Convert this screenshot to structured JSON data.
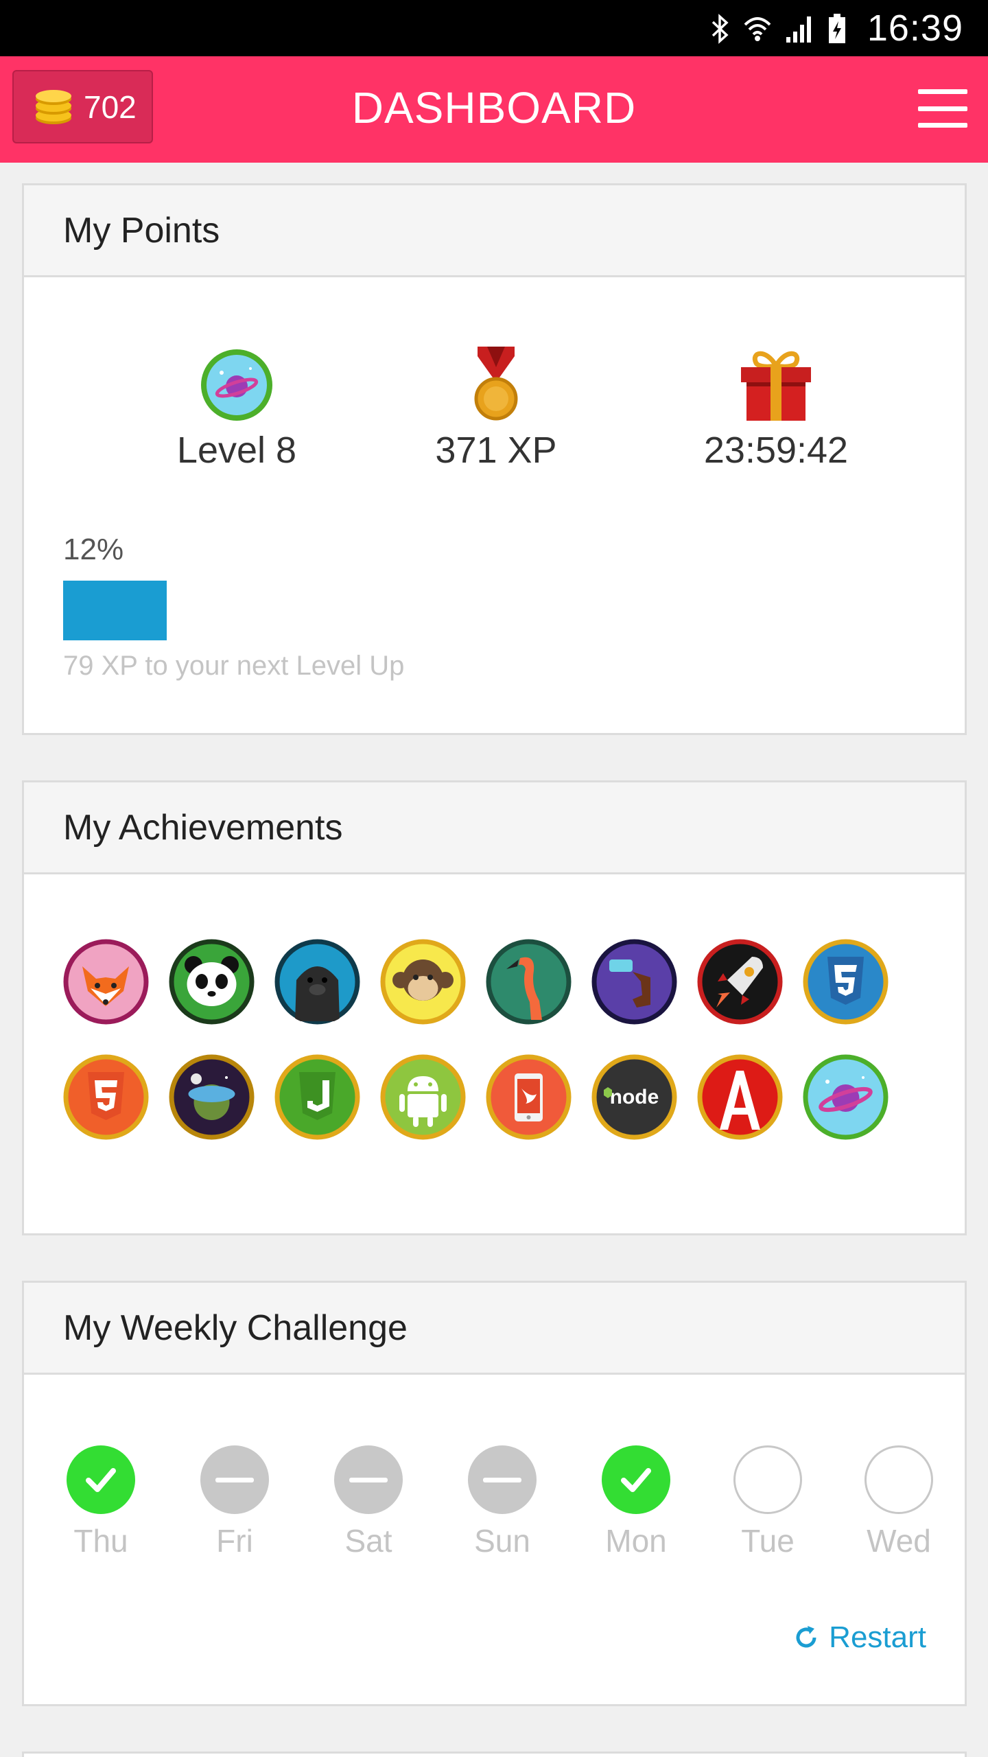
{
  "status_bar": {
    "time": "16:39",
    "icons": [
      "bluetooth-icon",
      "wifi-icon",
      "signal-icon",
      "battery-icon"
    ]
  },
  "app_bar": {
    "coins": "702",
    "title": "DASHBOARD",
    "menu_icon": "hamburger-menu-icon"
  },
  "points": {
    "header": "My Points",
    "level": "Level 8",
    "xp": "371 XP",
    "timer": "23:59:42",
    "progress_label": "12%",
    "progress_fraction": 0.12,
    "progress_note": "79 XP to your next Level Up",
    "icons": [
      "level-planet-icon",
      "medal-icon",
      "gift-icon"
    ]
  },
  "achievements": {
    "header": "My Achievements",
    "badges": [
      "fox-badge",
      "panda-badge",
      "seal-badge",
      "monkey-badge",
      "flamingo-badge",
      "robot-arm-badge",
      "rocket-badge",
      "css3-badge",
      "html5-badge",
      "nasa-badge",
      "javascript-badge",
      "android-badge",
      "swift-badge",
      "nodejs-badge",
      "angular-badge",
      "planet-badge"
    ]
  },
  "weekly": {
    "header": "My Weekly Challenge",
    "days": [
      {
        "label": "Thu",
        "status": "done"
      },
      {
        "label": "Fri",
        "status": "missed"
      },
      {
        "label": "Sat",
        "status": "missed"
      },
      {
        "label": "Sun",
        "status": "missed"
      },
      {
        "label": "Mon",
        "status": "done"
      },
      {
        "label": "Tue",
        "status": "pending"
      },
      {
        "label": "Wed",
        "status": "pending"
      }
    ],
    "restart_label": "Restart"
  },
  "colors": {
    "accent": "#ff3366",
    "progress": "#1a9dd2",
    "done": "#33dd33",
    "missed": "#c8c8c8"
  }
}
